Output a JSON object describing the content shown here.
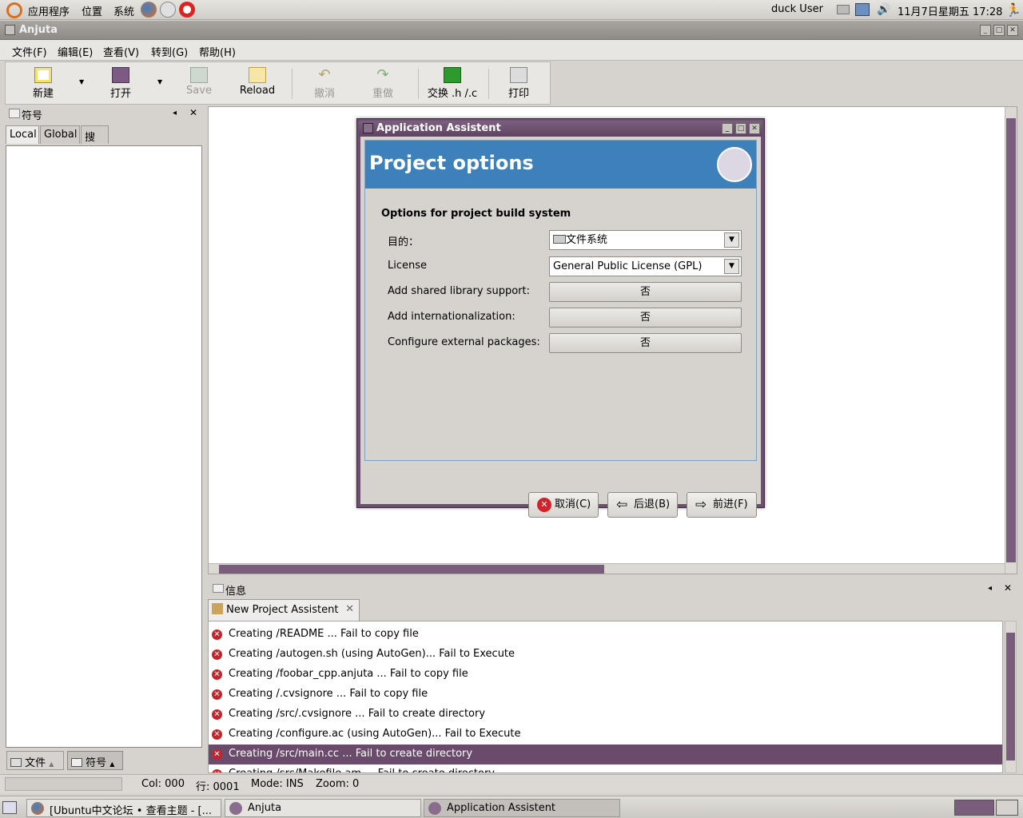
{
  "top_panel": {
    "applications": "应用程序",
    "places": "位置",
    "system": "系统",
    "user": "duck User",
    "datetime": "11月7日星期五  17:28"
  },
  "window": {
    "title": "Anjuta"
  },
  "menubar": [
    "文件(F)",
    "编辑(E)",
    "查看(V)",
    "转到(G)",
    "帮助(H)"
  ],
  "toolbar": {
    "new": "新建",
    "open": "打开",
    "save": "Save",
    "reload": "Reload",
    "undo": "撤消",
    "redo": "重做",
    "swap": "交换 .h /.c",
    "print": "打印"
  },
  "left_panel": {
    "title": "符号",
    "tabs": [
      "Local",
      "Global",
      "搜索"
    ],
    "bottom_tabs": [
      "文件",
      "符号"
    ]
  },
  "messages": {
    "title": "信息",
    "tab": "New Project Assistent",
    "rows": [
      "Creating /README ... Fail to copy file",
      "Creating /autogen.sh (using AutoGen)... Fail to Execute",
      "Creating /foobar_cpp.anjuta ... Fail to copy file",
      "Creating /.cvsignore ... Fail to copy file",
      "Creating /src/.cvsignore ... Fail to create directory",
      "Creating /configure.ac (using AutoGen)... Fail to Execute",
      "Creating /src/main.cc ... Fail to create directory",
      "Creating /src/Makefile.am ... Fail to create directory"
    ],
    "selected_index": 6
  },
  "statusbar": {
    "col": "Col: 000",
    "line": "行: 0001",
    "mode": "Mode: INS",
    "zoom": "Zoom: 0"
  },
  "taskbar": [
    "[Ubuntu中文论坛 • 查看主题 - [...",
    "Anjuta",
    "Application Assistent"
  ],
  "dialog": {
    "title": "Application Assistent",
    "header": "Project options",
    "section": "Options for project build system",
    "options": [
      {
        "label": "目的：",
        "value": "文件系统",
        "kind": "combo"
      },
      {
        "label": "License",
        "value": "General Public License (GPL)",
        "kind": "combo"
      },
      {
        "label": "Add shared library support:",
        "value": "否",
        "kind": "button"
      },
      {
        "label": "Add internationalization:",
        "value": "否",
        "kind": "button"
      },
      {
        "label": "Configure external packages:",
        "value": "否",
        "kind": "button"
      }
    ],
    "buttons": {
      "cancel": "取消(C)",
      "back": "后退(B)",
      "forward": "前进(F)"
    }
  },
  "colors": {
    "accent": "#6a4b6c",
    "header_blue": "#3e80ba",
    "error": "#c2262c"
  }
}
